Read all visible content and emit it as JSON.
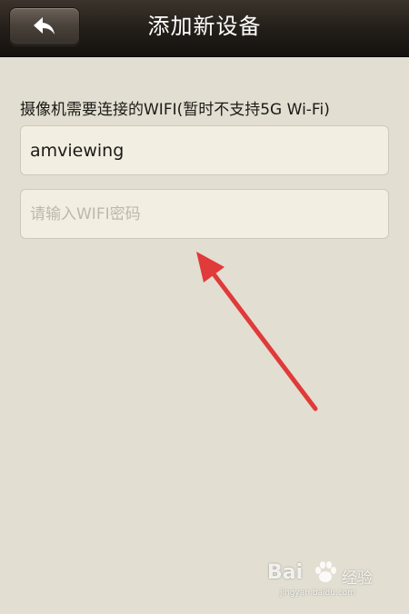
{
  "header": {
    "title": "添加新设备",
    "back_icon": "back-arrow-icon"
  },
  "form": {
    "label": "摄像机需要连接的WIFI(暂时不支持5G Wi-Fi)",
    "ssid_value": "amviewing",
    "password_placeholder": "请输入WIFI密码"
  },
  "annotation": {
    "arrow_color": "#e03a3a"
  },
  "watermark": {
    "brand": "Bai",
    "word": "经验",
    "url": "jingyan.baidu.com"
  },
  "colors": {
    "background": "#e2ded1",
    "header": "#221d18",
    "field": "#f2eee2"
  }
}
